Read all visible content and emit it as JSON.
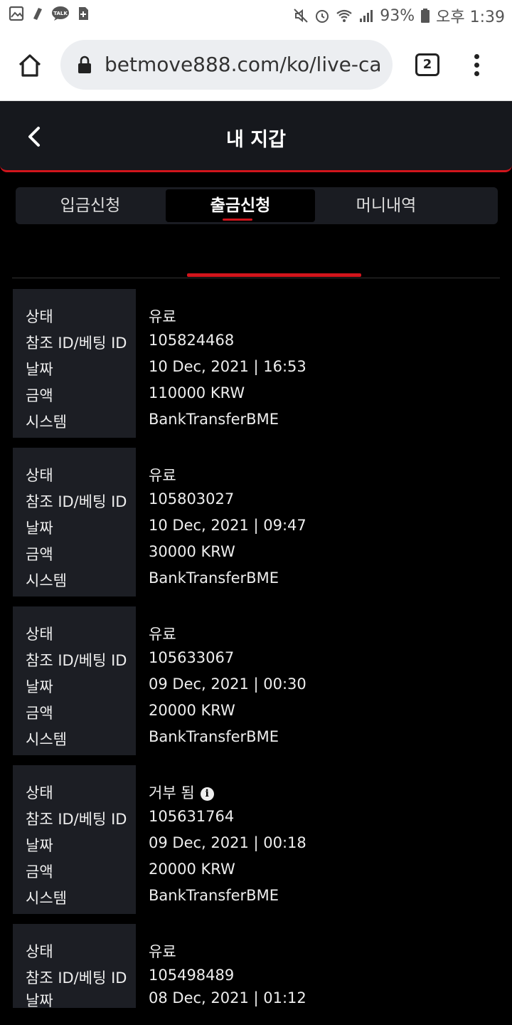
{
  "statusbar": {
    "battery": "93%",
    "time": "오후 1:39"
  },
  "browser": {
    "url": "betmove888.com/ko/live-casino",
    "tab_count": "2"
  },
  "header": {
    "title": "내 지갑"
  },
  "tabs": [
    {
      "label": "입금신청"
    },
    {
      "label": "출금신청"
    },
    {
      "label": "머니내역"
    }
  ],
  "labels": {
    "status": "상태",
    "ref_id": "참조 ID/베팅 ID",
    "date": "날짜",
    "amount": "금액",
    "system": "시스템"
  },
  "records": [
    {
      "status": "유료",
      "ref_id": "105824468",
      "date": "10 Dec, 2021 | 16:53",
      "amount": "110000 KRW",
      "system": "BankTransferBME"
    },
    {
      "status": "유료",
      "ref_id": "105803027",
      "date": "10 Dec, 2021 | 09:47",
      "amount": "30000 KRW",
      "system": "BankTransferBME"
    },
    {
      "status": "유료",
      "ref_id": "105633067",
      "date": "09 Dec, 2021 | 00:30",
      "amount": "20000 KRW",
      "system": "BankTransferBME"
    },
    {
      "status": "거부 됨",
      "ref_id": "105631764",
      "date": "09 Dec, 2021 | 00:18",
      "amount": "20000 KRW",
      "system": "BankTransferBME"
    },
    {
      "status": "유료",
      "ref_id": "105498489",
      "date": "08 Dec, 2021 | 01:12",
      "amount": "",
      "system": ""
    }
  ],
  "icons": {
    "info": "i"
  },
  "colors": {
    "accent": "#d1151c",
    "background": "#000000",
    "panel": "#1c1e24"
  }
}
